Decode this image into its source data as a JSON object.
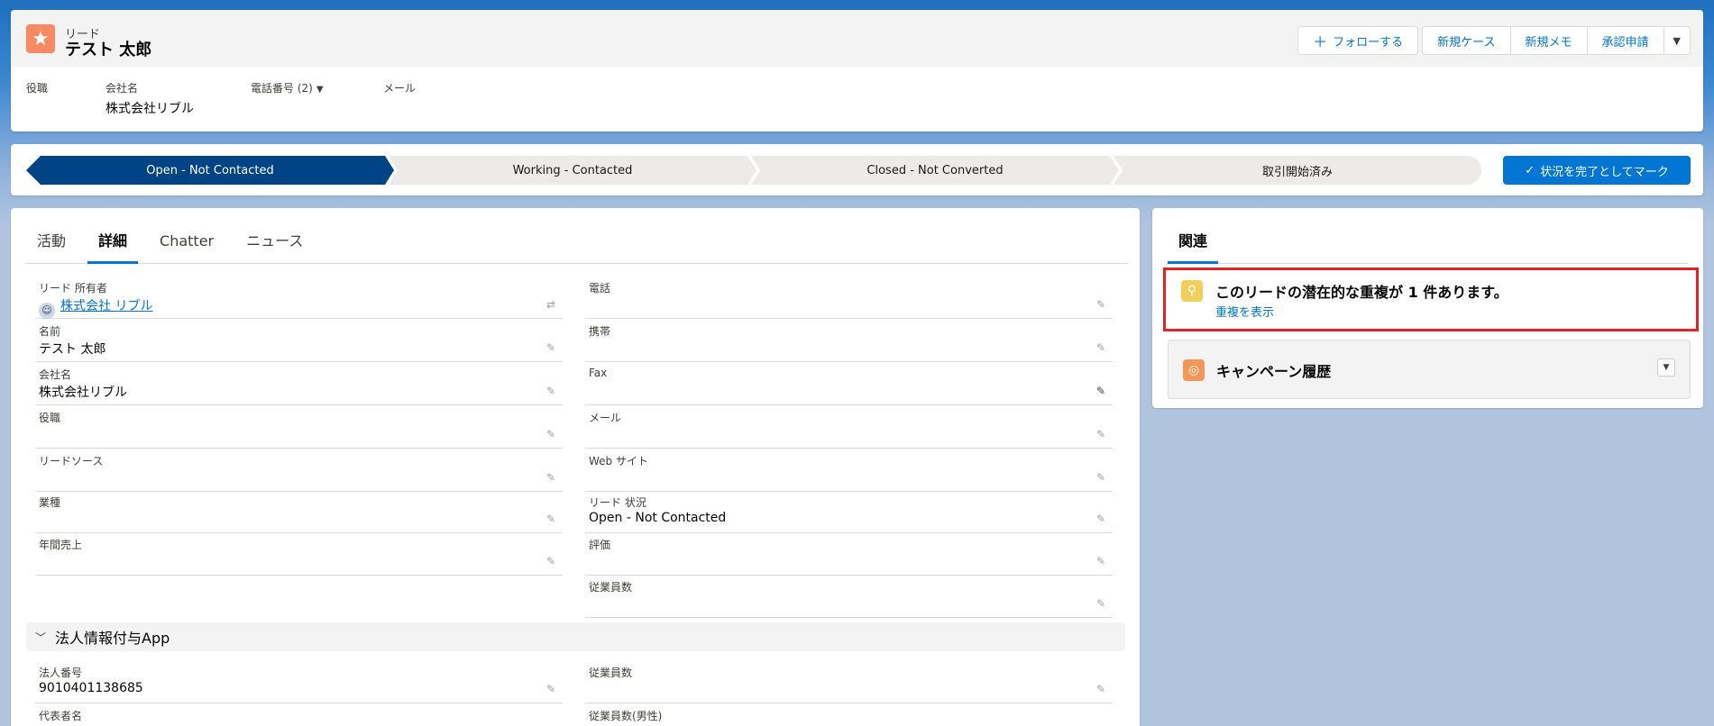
{
  "header": {
    "object_label": "リード",
    "record_name": "テスト 太郎",
    "actions": {
      "follow": "フォローする",
      "new_case": "新規ケース",
      "new_note": "新規メモ",
      "approval": "承認申請"
    },
    "fields": {
      "title_label": "役職",
      "company_label": "会社名",
      "company_value": "株式会社リブル",
      "phone_label": "電話番号 (2)",
      "email_label": "メール"
    }
  },
  "path": {
    "steps": [
      "Open - Not Contacted",
      "Working - Contacted",
      "Closed - Not Converted",
      "取引開始済み"
    ],
    "active_index": 0,
    "mark_complete": "状況を完了としてマーク"
  },
  "tabs": [
    "活動",
    "詳細",
    "Chatter",
    "ニュース"
  ],
  "active_tab": "詳細",
  "detail": {
    "left": [
      {
        "label": "リード 所有者",
        "value": "株式会社 リブル"
      },
      {
        "label": "名前",
        "value": "テスト 太郎"
      },
      {
        "label": "会社名",
        "value": "株式会社リブル"
      },
      {
        "label": "役職",
        "value": ""
      },
      {
        "label": "リードソース",
        "value": ""
      },
      {
        "label": "業種",
        "value": ""
      },
      {
        "label": "年間売上",
        "value": ""
      }
    ],
    "right": [
      {
        "label": "電話",
        "value": ""
      },
      {
        "label": "携帯",
        "value": ""
      },
      {
        "label": "Fax",
        "value": ""
      },
      {
        "label": "メール",
        "value": ""
      },
      {
        "label": "Web サイト",
        "value": ""
      },
      {
        "label": "リード 状況",
        "value": "Open - Not Contacted"
      },
      {
        "label": "評価",
        "value": ""
      },
      {
        "label": "従業員数",
        "value": ""
      }
    ],
    "section_title": "法人情報付与App",
    "section_fields_left": [
      {
        "label": "法人番号",
        "value": "9010401138685"
      },
      {
        "label": "代表者名",
        "value": ""
      }
    ],
    "section_fields_right": [
      {
        "label": "従業員数",
        "value": ""
      },
      {
        "label": "従業員数(男性)",
        "value": ""
      }
    ]
  },
  "related": {
    "tab": "関連",
    "duplicate_title": "このリードの潜在的な重複が 1 件あります。",
    "duplicate_link": "重複を表示",
    "campaign_title": "キャンペーン履歴"
  },
  "colors": {
    "brand": "#0176d3",
    "path_active": "#014486",
    "lead_icon": "#f88962",
    "highlight_border": "#e02424"
  }
}
